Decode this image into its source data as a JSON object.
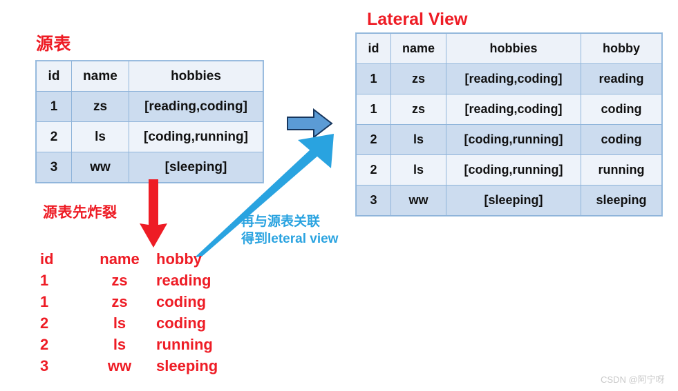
{
  "source_section": {
    "title": "源表",
    "columns": [
      "id",
      "name",
      "hobbies"
    ],
    "rows": [
      [
        "1",
        "zs",
        "[reading,coding]"
      ],
      [
        "2",
        "ls",
        "[coding,running]"
      ],
      [
        "3",
        "ww",
        "[sleeping]"
      ]
    ]
  },
  "lateral_section": {
    "title": "Lateral View",
    "columns": [
      "id",
      "name",
      "hobbies",
      "hobby"
    ],
    "rows": [
      [
        "1",
        "zs",
        "[reading,coding]",
        "reading"
      ],
      [
        "1",
        "zs",
        "[reading,coding]",
        "coding"
      ],
      [
        "2",
        "ls",
        "[coding,running]",
        "coding"
      ],
      [
        "2",
        "ls",
        "[coding,running]",
        "running"
      ],
      [
        "3",
        "ww",
        "[sleeping]",
        "sleeping"
      ]
    ]
  },
  "exploded_section": {
    "note": "源表先炸裂",
    "columns": [
      "id",
      "name",
      "hobby"
    ],
    "rows": [
      [
        "1",
        "zs",
        "reading"
      ],
      [
        "1",
        "zs",
        "coding"
      ],
      [
        "2",
        "ls",
        "coding"
      ],
      [
        "2",
        "ls",
        "running"
      ],
      [
        "3",
        "ww",
        "sleeping"
      ]
    ]
  },
  "join_note": {
    "line1": "再与源表关联",
    "line2": "得到leteral view"
  },
  "watermark": "CSDN @阿宁呀",
  "colors": {
    "red": "#ee1c25",
    "blue_note": "#2aa3e0",
    "table_border": "#8fb4da",
    "row_odd": "#ccdcef",
    "row_even": "#eef3fa",
    "header": "#edf2f9",
    "block_arrow": "#5b9bd5",
    "cyan_arrow": "#29a3e0"
  }
}
